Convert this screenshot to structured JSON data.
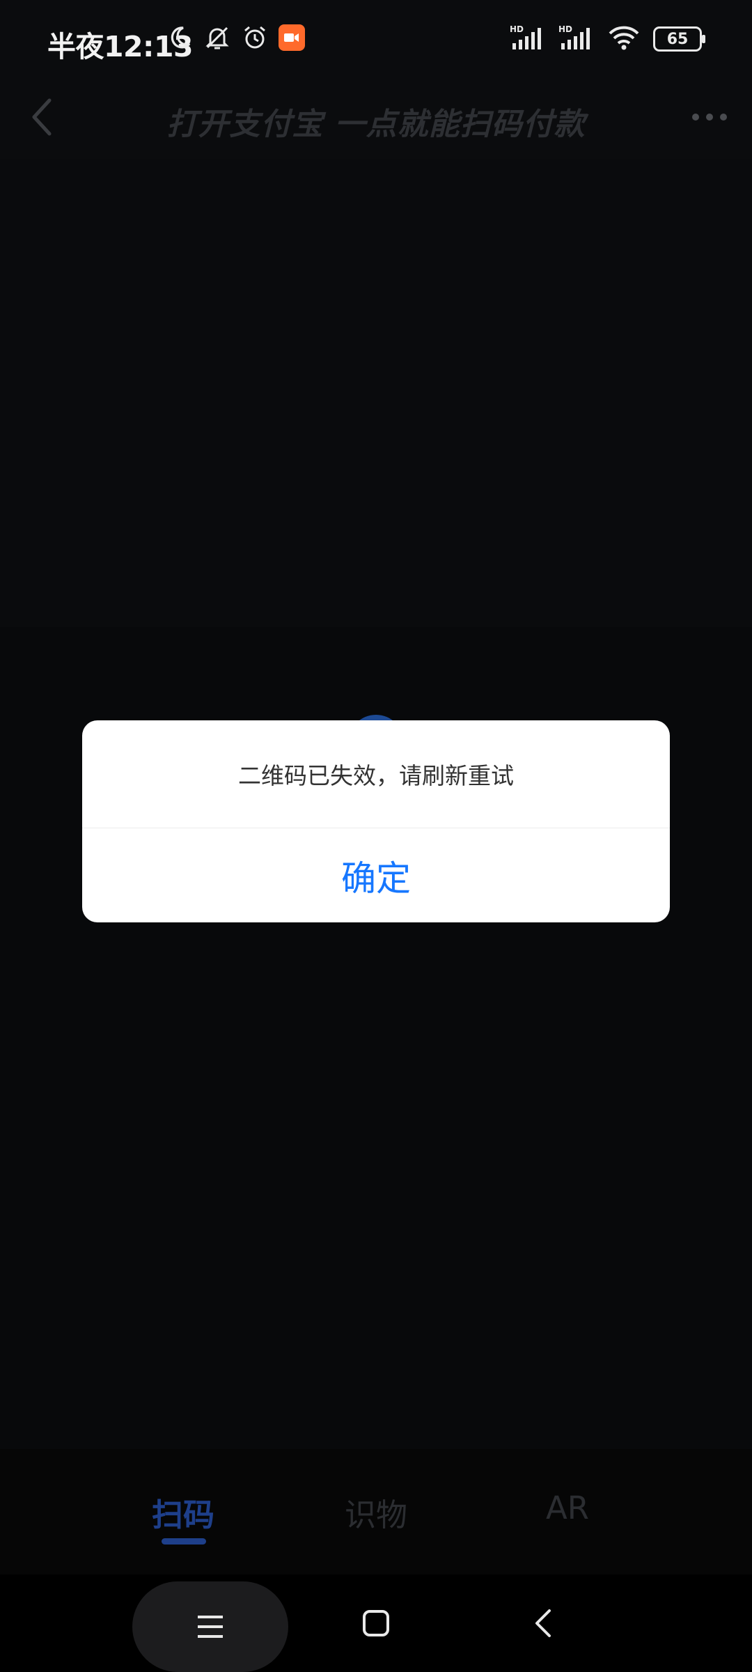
{
  "status_bar": {
    "time": "半夜12:13",
    "battery": "65",
    "icons": [
      "moon-icon",
      "mute-icon",
      "alarm-icon",
      "screen-recorder-icon",
      "hd-signal-icon",
      "hd-signal-icon",
      "wifi-icon",
      "battery-icon"
    ]
  },
  "nav": {
    "title": "打开支付宝 一点就能扫码付款",
    "back_icon": "chevron-left-icon",
    "more_icon": "more-dots-icon"
  },
  "dialog": {
    "message": "二维码已失效，请刷新重试",
    "confirm_label": "确定",
    "confirm_color": "#1677ff"
  },
  "tabs": {
    "items": [
      {
        "label": "扫码",
        "active": true
      },
      {
        "label": "识物",
        "active": false
      },
      {
        "label": "AR",
        "active": false
      }
    ],
    "active_color": "#1e3f8a"
  },
  "system_nav": {
    "recent_icon": "menu-lines-icon",
    "home_icon": "home-square-icon",
    "back_icon": "back-chevron-icon"
  }
}
